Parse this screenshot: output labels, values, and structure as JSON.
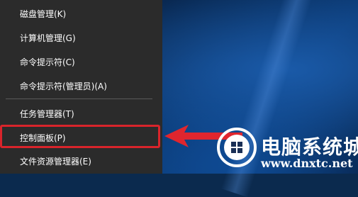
{
  "context_menu": {
    "items": [
      {
        "label": "磁盘管理(K)"
      },
      {
        "label": "计算机管理(G)"
      },
      {
        "label": "命令提示符(C)"
      },
      {
        "label": "命令提示符(管理员)(A)"
      },
      {
        "label": "任务管理器(T)"
      },
      {
        "label": "控制面板(P)"
      },
      {
        "label": "文件资源管理器(E)"
      }
    ],
    "highlighted_item": "控制面板(P)"
  },
  "watermark": {
    "brand": "电脑系统城",
    "url": "www.dnxtc.net"
  },
  "colors": {
    "menu_bg": "#2b2b2b",
    "highlight": "#d9242b",
    "desktop": "#0a2f5e"
  }
}
